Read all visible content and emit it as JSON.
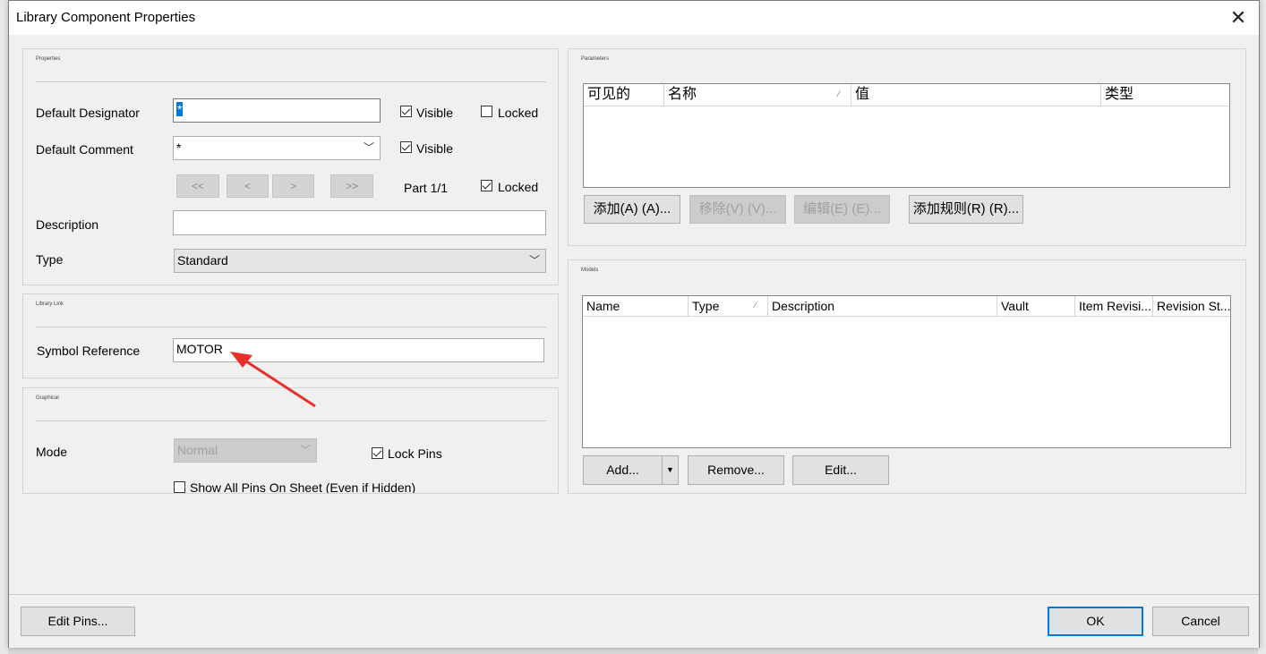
{
  "dialog": {
    "title": "Library Component Properties",
    "close": "✕"
  },
  "properties": {
    "group_title": "Properties",
    "default_designator_label": "Default Designator",
    "default_designator_value": "*",
    "default_comment_label": "Default Comment",
    "default_comment_value": "*",
    "visible_label": "Visible",
    "locked_label": "Locked",
    "nav": {
      "first": "<<",
      "prev": "<",
      "next": ">",
      "last": ">>"
    },
    "part_label": "Part 1/1",
    "description_label": "Description",
    "description_value": "",
    "type_label": "Type",
    "type_value": "Standard",
    "designator_visible": true,
    "designator_locked": false,
    "comment_visible": true,
    "part_locked": true
  },
  "library_link": {
    "group_title": "Library Link",
    "symbol_reference_label": "Symbol Reference",
    "symbol_reference_value": "MOTOR"
  },
  "graphical": {
    "group_title": "Graphical",
    "mode_label": "Mode",
    "mode_value": "Normal",
    "lock_pins_label": "Lock Pins",
    "lock_pins_checked": true,
    "show_all_pins_label": "Show All Pins On Sheet (Even if Hidden)",
    "show_all_pins_checked": false
  },
  "parameters": {
    "group_title": "Parameters",
    "columns": [
      "可见的",
      "名称",
      "值",
      "类型"
    ],
    "buttons": {
      "add": "添加(A) (A)...",
      "remove": "移除(V) (V)...",
      "edit": "编辑(E) (E)...",
      "add_rule": "添加规则(R) (R)..."
    }
  },
  "models": {
    "group_title": "Models",
    "columns": [
      "Name",
      "Type",
      "Description",
      "Vault",
      "Item Revisi...",
      "Revision St..."
    ],
    "buttons": {
      "add": "Add...",
      "remove": "Remove...",
      "edit": "Edit..."
    }
  },
  "footer": {
    "edit_pins": "Edit Pins...",
    "ok": "OK",
    "cancel": "Cancel"
  },
  "colors": {
    "accent": "#0078d7",
    "annotation_arrow": "#e8302a"
  }
}
